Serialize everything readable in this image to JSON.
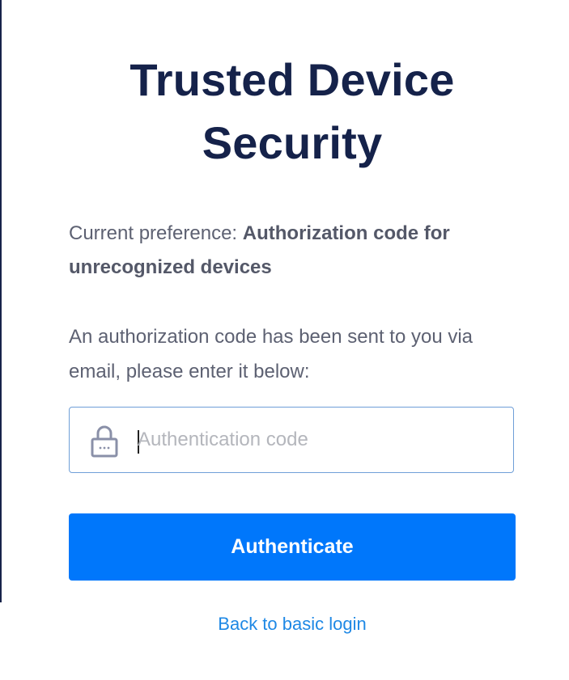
{
  "page": {
    "title_line1": "Trusted Device",
    "title_line2": "Security"
  },
  "preference": {
    "label": "Current preference: ",
    "value": "Authorization code for unrecognized devices"
  },
  "message": "An authorization code has been sent to you via email, please enter it below:",
  "code_field": {
    "icon": "lock-icon",
    "value": "",
    "placeholder": "Authentication code"
  },
  "authenticate_button": {
    "label": "Authenticate"
  },
  "back_link": {
    "label": "Back to basic login"
  },
  "colors": {
    "title": "#15224a",
    "body_text": "#5d6172",
    "primary": "#0077fb",
    "link": "#1e88e5",
    "field_border": "#6f9fd8"
  }
}
